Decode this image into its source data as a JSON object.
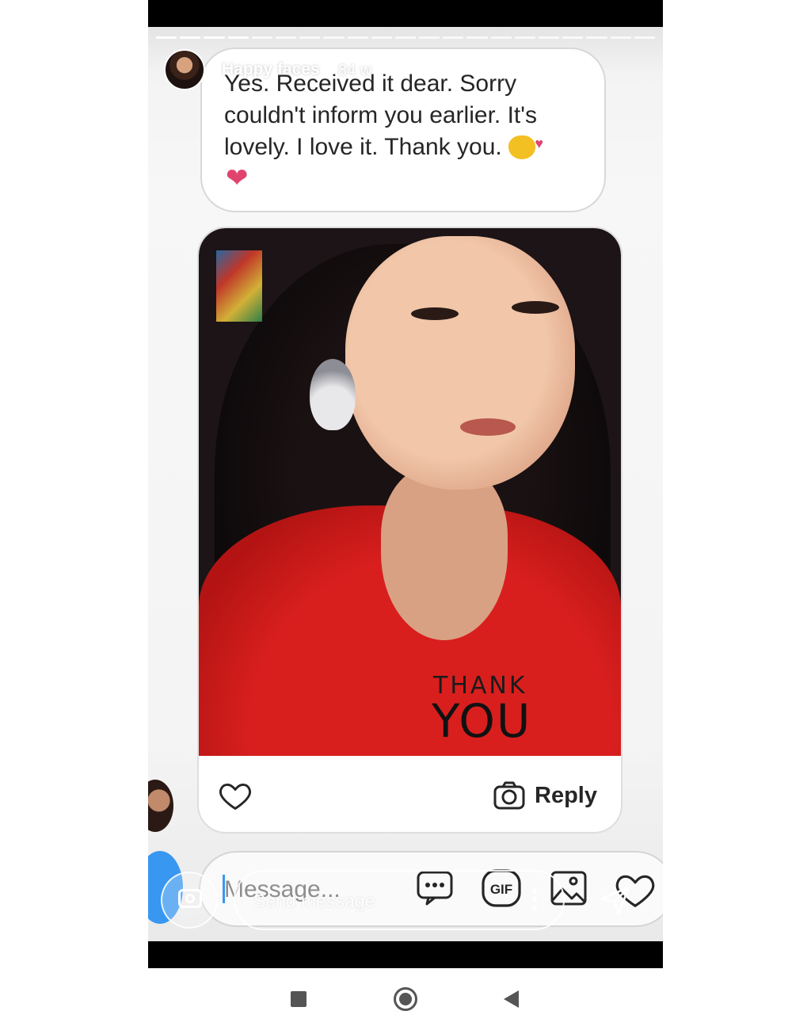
{
  "story": {
    "username": "Happy faces",
    "time_ago": "84 w",
    "progress": {
      "total_segments": 21,
      "completed_segments": 4
    }
  },
  "message": {
    "text": "Yes. Received it dear. Sorry couldn't inform you earlier. It's lovely. I love it. Thank you."
  },
  "photo_post": {
    "overlay_line1": "THANK",
    "overlay_line2": "YOU",
    "reply_label": "Reply"
  },
  "composer": {
    "placeholder": "Message..."
  },
  "story_reply": {
    "send_placeholder": "Send message"
  },
  "icons": {
    "like": "heart-outline-icon",
    "reply_camera": "camera-icon",
    "more": "more-options-icon",
    "gif": "gif-icon",
    "gallery": "image-icon",
    "composer_like": "heart-outline-icon",
    "share": "send-icon",
    "kiss": "kissing-face-emoji",
    "heart_emoji": "red-heart-emoji"
  },
  "colors": {
    "accent": "#3897f0",
    "heart_emoji": "#e0446e",
    "shirt_red": "#d81f1e"
  }
}
